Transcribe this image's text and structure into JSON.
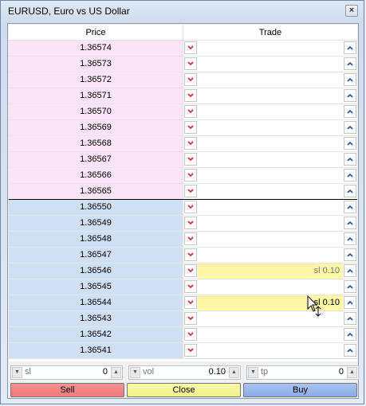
{
  "window": {
    "title": "EURUSD, Euro vs US Dollar",
    "close_glyph": "×"
  },
  "table": {
    "headers": {
      "price": "Price",
      "trade": "Trade"
    },
    "ask_rows": [
      {
        "price": "1.36574"
      },
      {
        "price": "1.36573"
      },
      {
        "price": "1.36572"
      },
      {
        "price": "1.36571"
      },
      {
        "price": "1.36570"
      },
      {
        "price": "1.36569"
      },
      {
        "price": "1.36568"
      },
      {
        "price": "1.36567"
      },
      {
        "price": "1.36566"
      },
      {
        "price": "1.36565"
      }
    ],
    "bid_rows": [
      {
        "price": "1.36550"
      },
      {
        "price": "1.36549"
      },
      {
        "price": "1.36548"
      },
      {
        "price": "1.36547"
      },
      {
        "price": "1.36546",
        "order": "sl 0.10",
        "order_state": "pending"
      },
      {
        "price": "1.36545"
      },
      {
        "price": "1.36544",
        "order": "sl 0.10",
        "order_state": "active"
      },
      {
        "price": "1.36543"
      },
      {
        "price": "1.36542"
      },
      {
        "price": "1.36541"
      }
    ]
  },
  "controls": {
    "sl": {
      "label": "sl",
      "value": "0"
    },
    "vol": {
      "label": "vol",
      "value": "0.10"
    },
    "tp": {
      "label": "tp",
      "value": "0"
    }
  },
  "buttons": {
    "sell": "Sell",
    "close": "Close",
    "buy": "Buy"
  },
  "colors": {
    "ask_bg": "#fbe4f7",
    "bid_bg": "#cfe0f5",
    "order_bg": "#fbf7a5",
    "sell": "#ef7a7a",
    "close": "#f1f08c",
    "buy": "#8cabe6"
  },
  "icons": {
    "sell_arrow": "chevron-down-icon",
    "buy_arrow": "chevron-up-icon",
    "cursor": "drag-cursor-icon"
  }
}
